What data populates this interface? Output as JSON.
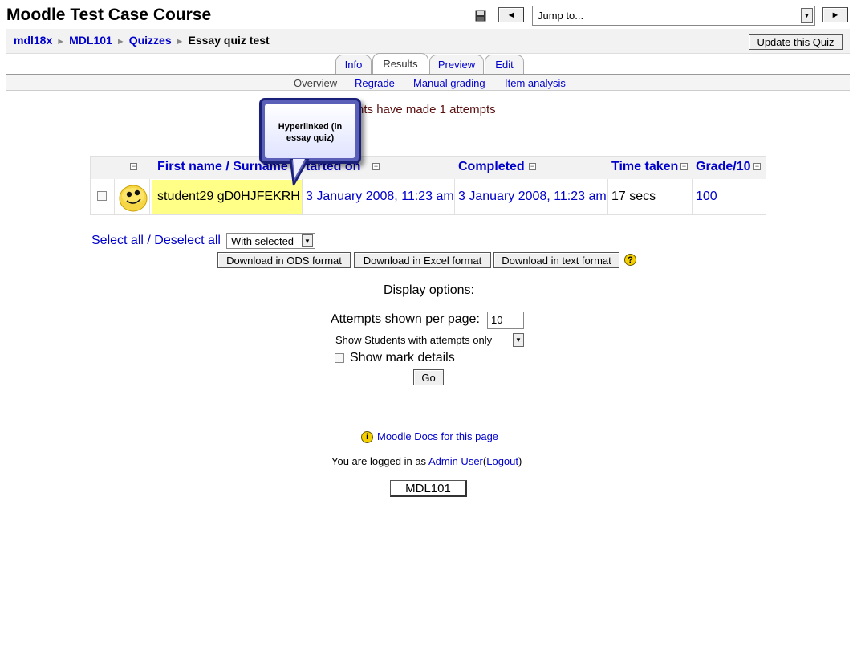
{
  "header": {
    "course_title": "Moodle Test Case Course",
    "jump_to": "Jump to...",
    "prev_arrow": "◄",
    "next_arrow": "►"
  },
  "breadcrumb": {
    "items": [
      "mdl18x",
      "MDL101",
      "Quizzes"
    ],
    "current": "Essay quiz test",
    "separator": "►"
  },
  "update_button": "Update this Quiz",
  "tabs": [
    {
      "label": "Info",
      "active": false
    },
    {
      "label": "Results",
      "active": true
    },
    {
      "label": "Preview",
      "active": false
    },
    {
      "label": "Edit",
      "active": false
    }
  ],
  "subtabs": [
    {
      "label": "Overview",
      "active": true
    },
    {
      "label": "Regrade",
      "active": false
    },
    {
      "label": "Manual grading",
      "active": false
    },
    {
      "label": "Item analysis",
      "active": false
    }
  ],
  "attempts_message": "udents have made 1 attempts",
  "callout": {
    "line1": "Hyperlinked (in",
    "line2": "essay quiz)"
  },
  "table": {
    "columns": [
      "First name / Surname",
      "Started on",
      "Completed",
      "Time taken",
      "Grade/10"
    ],
    "started_header_visible": "tarted on",
    "rows": [
      {
        "name": "student29 gD0HJFEKRH",
        "started": "3 January 2008, 11:23 am",
        "completed": "3 January 2008, 11:23 am",
        "time_taken": "17 secs",
        "grade": "100"
      }
    ]
  },
  "select_all": "Select all",
  "select_sep": " / ",
  "deselect_all": "Deselect all",
  "with_selected": "With selected",
  "download": {
    "ods": "Download in ODS format",
    "excel": "Download in Excel format",
    "text": "Download in text format"
  },
  "help_icon": "?",
  "display_options": {
    "title": "Display options:",
    "attempts_label": "Attempts shown per page:",
    "attempts_value": "10",
    "show_students": "Show Students with attempts only",
    "mark_details": "Show mark details",
    "go": "Go"
  },
  "footer": {
    "docs_link": "Moodle Docs for this page",
    "docs_icon": "i",
    "logged_in_prefix": "You are logged in as ",
    "user": "Admin User",
    "logout": "Logout",
    "course_button": "MDL101"
  },
  "colors": {
    "link": "#0000cc",
    "highlight": "#ffff88",
    "callout_border": "#1a1f77",
    "message": "#5a1010"
  }
}
